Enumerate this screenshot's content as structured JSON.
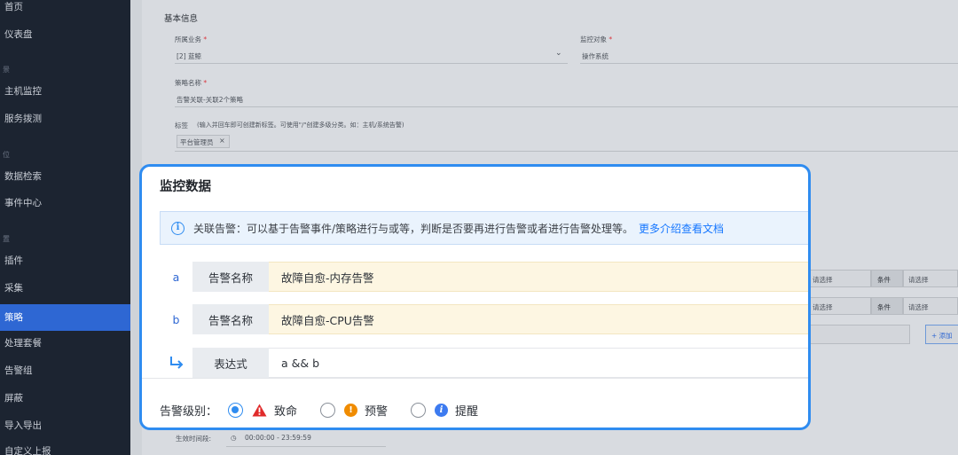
{
  "sidebar": {
    "items": [
      {
        "label": "首页"
      },
      {
        "label": "仪表盘"
      },
      {
        "label": "主机监控"
      },
      {
        "label": "服务拨测"
      },
      {
        "label": "数据检索"
      },
      {
        "label": "事件中心"
      },
      {
        "label": "插件"
      },
      {
        "label": "采集"
      },
      {
        "label": "策略",
        "active": true
      },
      {
        "label": "处理套餐"
      },
      {
        "label": "告警组"
      },
      {
        "label": "屏蔽"
      },
      {
        "label": "导入导出"
      },
      {
        "label": "自定义上报"
      }
    ],
    "groups": [
      "景",
      "位",
      "置"
    ]
  },
  "background": {
    "section_title": "基本信息",
    "business_label": "所属业务",
    "business_value": "[2] 蓝鲸",
    "target_label": "监控对象",
    "target_value": "操作系统",
    "strategy_name_label": "策略名称",
    "strategy_name_value": "告警关联-关联2个策略",
    "tag_label": "标签",
    "tag_hint": "(输入并回车即可创建新标签。可使用\"/\"创建多级分类。如：主机/系统告警)",
    "tag_value": "平台管理员",
    "select_placeholder": "请选择",
    "condition_label": "条件",
    "add_button": "+ 添加",
    "effective_time_label": "生效时间段:",
    "effective_time_value": "00:00:00 - 23:59:59"
  },
  "modal": {
    "title": "监控数据",
    "alert_text": "关联告警：可以基于告警事件/策略进行与或等，判断是否要再进行告警或者进行告警处理等。",
    "alert_link": "更多介绍查看文档",
    "conditions": [
      {
        "key": "a",
        "label": "告警名称",
        "value": "故障自愈-内存告警"
      },
      {
        "key": "b",
        "label": "告警名称",
        "value": "故障自愈-CPU告警"
      }
    ],
    "expression": {
      "label": "表达式",
      "value": "a && b"
    },
    "level": {
      "label": "告警级别：",
      "options": [
        {
          "label": "致命",
          "icon": "fatal-triangle-icon",
          "color": "#e02b2b",
          "checked": true
        },
        {
          "label": "预警",
          "icon": "warning-circle-icon",
          "color": "#f08c00",
          "checked": false
        },
        {
          "label": "提醒",
          "icon": "info-circle-icon",
          "color": "#3d7bf0",
          "checked": false
        }
      ]
    }
  },
  "colors": {
    "accent": "#2f8cf0",
    "sidebar_bg": "#1c2431",
    "active_item": "#2e67d3"
  }
}
